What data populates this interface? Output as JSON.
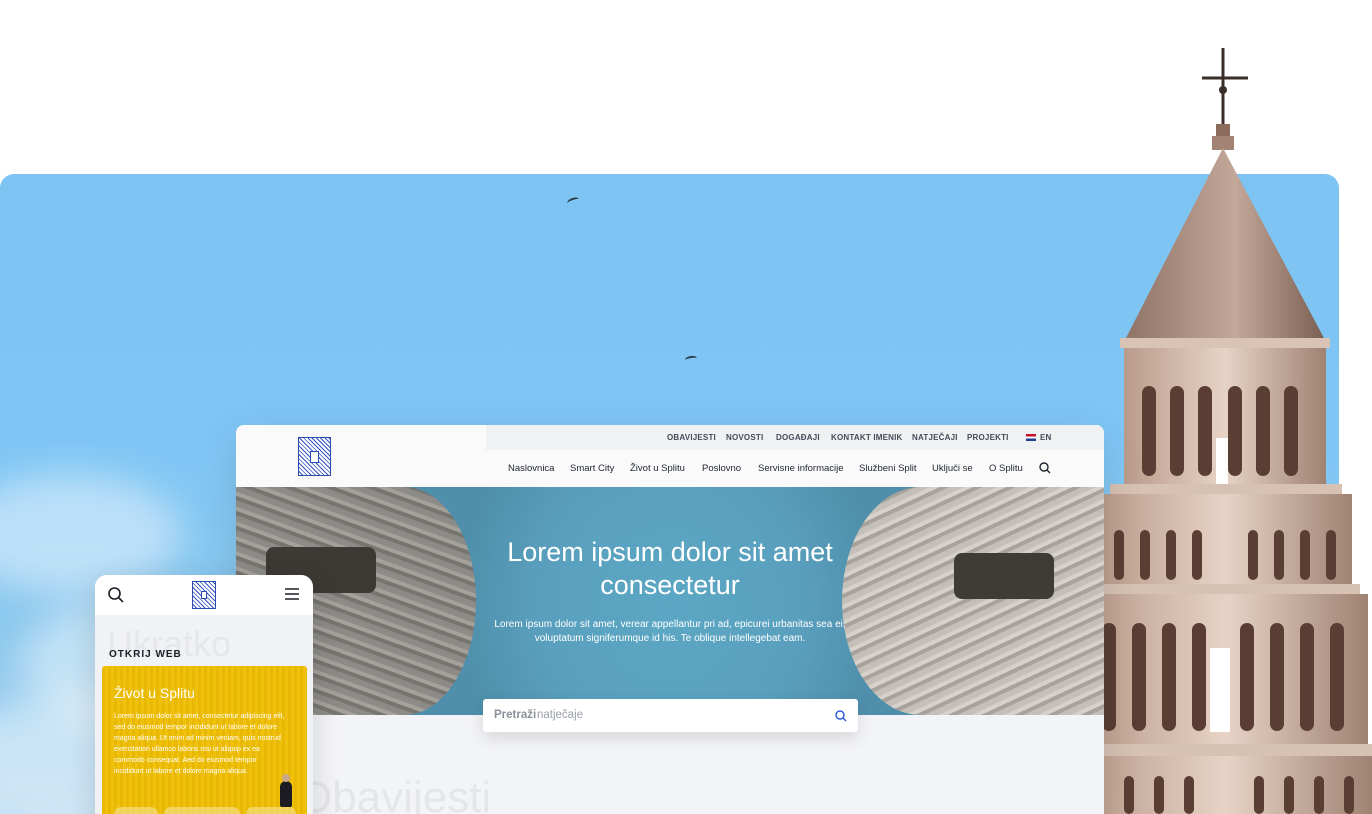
{
  "colors": {
    "sky": "#7ec4f3",
    "accent_blue": "#2b56d6",
    "card_yellow": "#edbf09",
    "nav_text": "#1f2530"
  },
  "desktop": {
    "utility_nav": [
      "OBAVIJESTI",
      "NOVOSTI",
      "DOGAĐAJI",
      "KONTAKT IMENIK",
      "NATJEČAJI",
      "PROJEKTI"
    ],
    "language": "EN",
    "main_nav": [
      "Naslovnica",
      "Smart City",
      "Život u Splitu",
      "Poslovno",
      "Servisne informacije",
      "Službeni Split",
      "Uključi se",
      "O Splitu"
    ],
    "hero": {
      "title": "Lorem ipsum dolor sit amet consectetur",
      "subtitle": "Lorem ipsum dolor sit amet, verear appellantur pri ad, epicurei urbanitas sea ei, voluptatum signiferumque id his. Te oblique intellegebat eam."
    },
    "search": {
      "label_bold": "Pretraži",
      "label_rest": "natječaje",
      "icon": "search-icon"
    },
    "section_ghost_title": "Obavijesti"
  },
  "mobile": {
    "ghost_title": "Ukratko",
    "eyebrow": "OTKRIJ WEB",
    "card": {
      "title": "Život u Splitu",
      "body": "Lorem ipsum dolor sit amet, consectetur adipiscing elit, sed do eiusmod tempor incididunt ut labore et dolore magna aliqua. Ut enim ad minim veniam, quis nostrud exercitation ullamco laboris nisi ut aliquip ex ea commodo consequat. Aed do eiusmod tempor incididunt ut labore et dolore magna aliqua."
    },
    "icons": [
      "search-icon",
      "hamburger-menu-icon"
    ]
  }
}
